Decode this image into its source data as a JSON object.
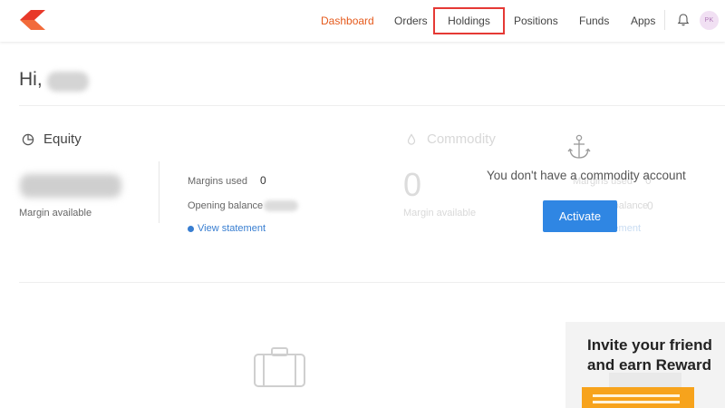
{
  "header": {
    "nav": [
      {
        "label": "Dashboard",
        "active": true
      },
      {
        "label": "Orders",
        "active": false
      },
      {
        "label": "Holdings",
        "active": false,
        "highlighted": true
      },
      {
        "label": "Positions",
        "active": false
      },
      {
        "label": "Funds",
        "active": false
      },
      {
        "label": "Apps",
        "active": false
      }
    ],
    "avatar_initials": "PK",
    "accent_color": "#e55a1c",
    "highlight_color": "#e53935"
  },
  "greeting": {
    "prefix": "Hi,"
  },
  "equity": {
    "title": "Equity",
    "icon": "pie-chart-icon",
    "margin_available_label": "Margin available",
    "margins_used_label": "Margins used",
    "margins_used_value": "0",
    "opening_balance_label": "Opening balance",
    "view_statement": "View statement"
  },
  "commodity": {
    "title": "Commodity",
    "icon": "drop-icon",
    "margin_value": "0",
    "margin_available_label": "Margin available",
    "margins_used_label": "Margins used",
    "margins_used_value": "0",
    "opening_balance_label": "Opening balance",
    "opening_balance_value": "0",
    "view_statement": "View statement",
    "no_account_message": "You don't have a commodity account",
    "activate_label": "Activate",
    "activate_color": "#2f86e3"
  },
  "promo": {
    "line1": "Invite your friend",
    "line2": "and earn Reward"
  }
}
